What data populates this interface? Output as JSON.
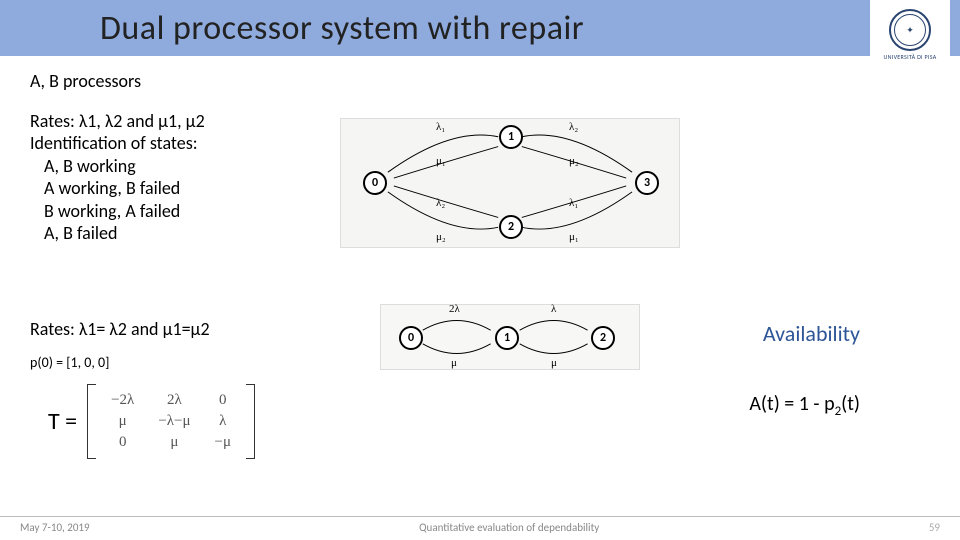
{
  "title": "Dual processor system with repair",
  "logo": {
    "uni": "UNIVERSITÀ DI PISA"
  },
  "ab": "A, B processors",
  "rates1": "Rates: λ1, λ2 and μ1, μ2",
  "states_header": "Identification of states:",
  "states": {
    "s0": "A, B working",
    "s1": "A working, B failed",
    "s2": "B working, A failed",
    "s3": "A, B failed"
  },
  "rates2": "Rates: λ1= λ2 and μ1=μ2",
  "p0": "p(0) = [1, 0, 0]",
  "T": "T =",
  "matrix": {
    "r0c0": "−2λ",
    "r0c1": "2λ",
    "r0c2": "0",
    "r1c0": "μ",
    "r1c1": "−λ−μ",
    "r1c2": "λ",
    "r2c0": "0",
    "r2c1": "μ",
    "r2c2": "−μ"
  },
  "avail": "Availability",
  "at_prefix": "A(t) = 1 - p",
  "at_sub": "2",
  "at_suffix": "(t)",
  "dia1": {
    "n0": "0",
    "n1": "1",
    "n2": "2",
    "n3": "3",
    "l1a": "λ₁",
    "l2a": "λ₂",
    "m1a": "μ₁",
    "m2a": "μ₂",
    "l2b": "λ₂",
    "l1b": "λ₁",
    "m2b": "μ₂",
    "m1b": "μ₁"
  },
  "dia2": {
    "n0": "0",
    "n1": "1",
    "n2": "2",
    "tl": "2λ",
    "tr": "λ",
    "bl": "μ",
    "br": "μ"
  },
  "footer": {
    "date": "May 7-10, 2019",
    "mid": "Quantitative evaluation of dependability",
    "page": "59"
  }
}
